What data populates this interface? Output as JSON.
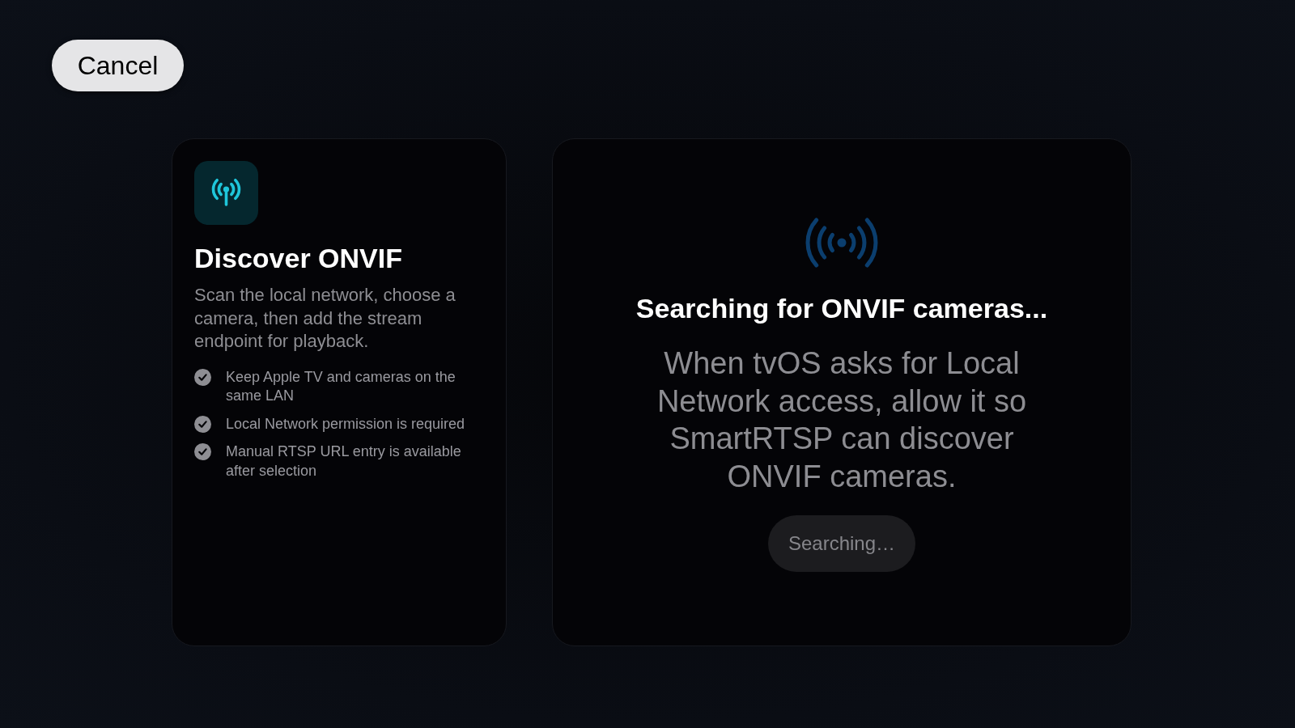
{
  "cancel_button": {
    "label": "Cancel"
  },
  "info_card": {
    "title": "Discover ONVIF",
    "description": "Scan the local network, choose a camera, then add the stream endpoint for playback.",
    "checklist": [
      {
        "text": "Keep Apple TV and cameras on the same LAN"
      },
      {
        "text": "Local Network permission is required"
      },
      {
        "text": "Manual RTSP URL entry is available after selection"
      }
    ]
  },
  "search_panel": {
    "heading": "Searching for ONVIF cameras...",
    "message": "When tvOS asks for Local Network access, allow it so SmartRTSP can discover ONVIF cameras.",
    "status_button": {
      "label": "Searching…",
      "disabled": true
    }
  }
}
